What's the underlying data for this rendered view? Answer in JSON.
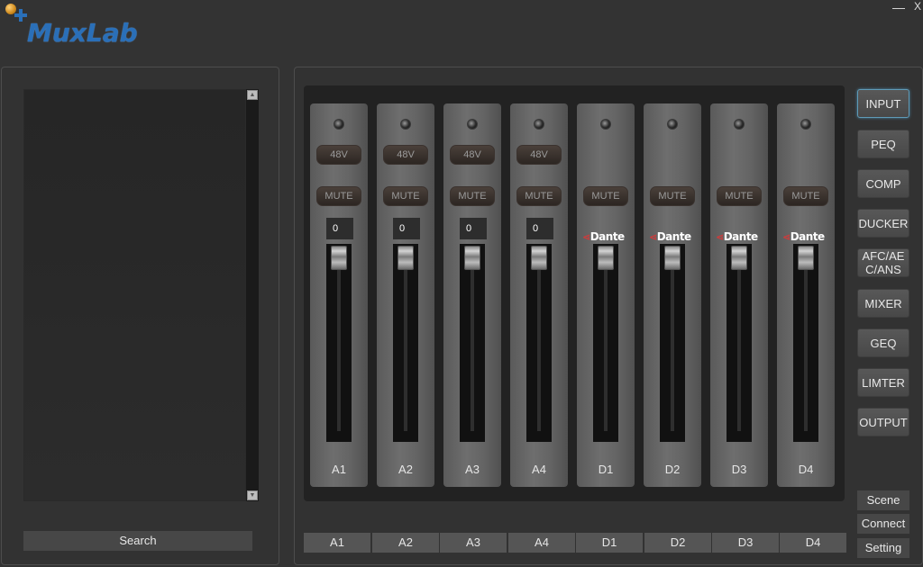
{
  "app": {
    "logo_text": "MuxLab",
    "minimize_label": "—",
    "close_label": "X"
  },
  "left_panel": {
    "search_label": "Search",
    "scroll_up_label": "▲",
    "scroll_down_label": "▼"
  },
  "channels": [
    {
      "name": "A1",
      "phantom_label": "48V",
      "mute_label": "MUTE",
      "gain": "0",
      "source": "analog",
      "fader_level": 1.0
    },
    {
      "name": "A2",
      "phantom_label": "48V",
      "mute_label": "MUTE",
      "gain": "0",
      "source": "analog",
      "fader_level": 1.0
    },
    {
      "name": "A3",
      "phantom_label": "48V",
      "mute_label": "MUTE",
      "gain": "0",
      "source": "analog",
      "fader_level": 1.0
    },
    {
      "name": "A4",
      "phantom_label": "48V",
      "mute_label": "MUTE",
      "gain": "0",
      "source": "analog",
      "fader_level": 1.0
    },
    {
      "name": "D1",
      "mute_label": "MUTE",
      "source": "Dante",
      "dante_label": "Dante",
      "fader_level": 1.0
    },
    {
      "name": "D2",
      "mute_label": "MUTE",
      "source": "Dante",
      "dante_label": "Dante",
      "fader_level": 1.0
    },
    {
      "name": "D3",
      "mute_label": "MUTE",
      "source": "Dante",
      "dante_label": "Dante",
      "fader_level": 1.0
    },
    {
      "name": "D4",
      "mute_label": "MUTE",
      "source": "Dante",
      "dante_label": "Dante",
      "fader_level": 1.0
    }
  ],
  "channel_tabs": [
    "A1",
    "A2",
    "A3",
    "A4",
    "D1",
    "D2",
    "D3",
    "D4"
  ],
  "side_menu": {
    "active": "INPUT",
    "items": [
      "INPUT",
      "PEQ",
      "COMP",
      "DUCKER",
      "AFC/AE\nC/ANS",
      "MIXER",
      "GEQ",
      "LIMTER",
      "OUTPUT"
    ]
  },
  "bottom_menu": [
    "Scene",
    "Connect",
    "Setting"
  ],
  "colors": {
    "background": "#333333",
    "accent_logo": "#2a6fb8",
    "active_border": "#5f9bb8",
    "dante_red": "#d23a3a"
  }
}
